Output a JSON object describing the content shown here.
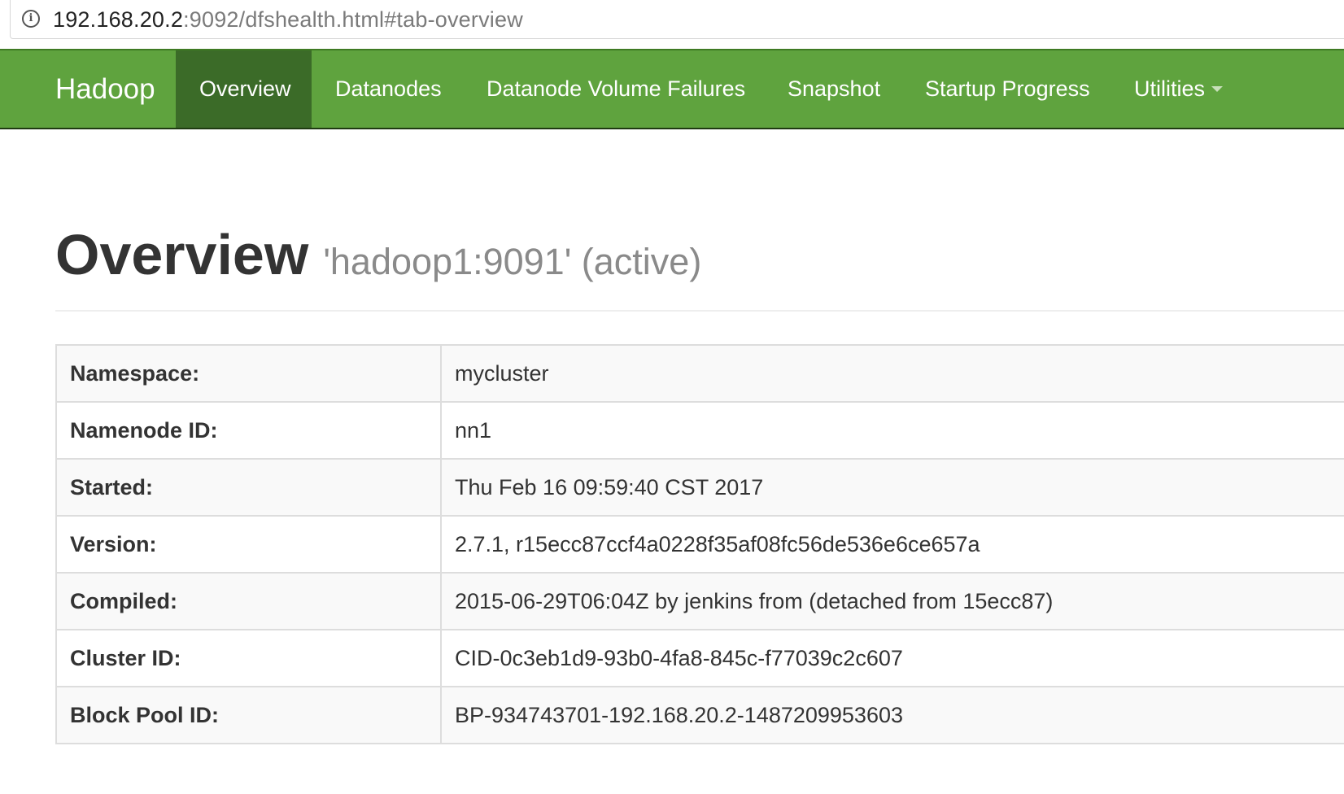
{
  "browser": {
    "url_host": "192.168.20.2",
    "url_rest": ":9092/dfshealth.html#tab-overview",
    "info_icon": "info-icon"
  },
  "navbar": {
    "brand": "Hadoop",
    "items": [
      {
        "label": "Overview",
        "active": true
      },
      {
        "label": "Datanodes",
        "active": false
      },
      {
        "label": "Datanode Volume Failures",
        "active": false
      },
      {
        "label": "Snapshot",
        "active": false
      },
      {
        "label": "Startup Progress",
        "active": false
      },
      {
        "label": "Utilities",
        "active": false,
        "dropdown": true
      }
    ],
    "colors": {
      "background": "#5fa33e",
      "active_background": "#3b6b28"
    }
  },
  "page": {
    "title": "Overview",
    "subtitle": "'hadoop1:9091' (active)"
  },
  "info_table": {
    "rows": [
      {
        "key": "Namespace:",
        "value": "mycluster"
      },
      {
        "key": "Namenode ID:",
        "value": "nn1"
      },
      {
        "key": "Started:",
        "value": "Thu Feb 16 09:59:40 CST 2017"
      },
      {
        "key": "Version:",
        "value": "2.7.1, r15ecc87ccf4a0228f35af08fc56de536e6ce657a"
      },
      {
        "key": "Compiled:",
        "value": "2015-06-29T06:04Z by jenkins from (detached from 15ecc87)"
      },
      {
        "key": "Cluster ID:",
        "value": "CID-0c3eb1d9-93b0-4fa8-845c-f77039c2c607"
      },
      {
        "key": "Block Pool ID:",
        "value": "BP-934743701-192.168.20.2-1487209953603"
      }
    ]
  }
}
